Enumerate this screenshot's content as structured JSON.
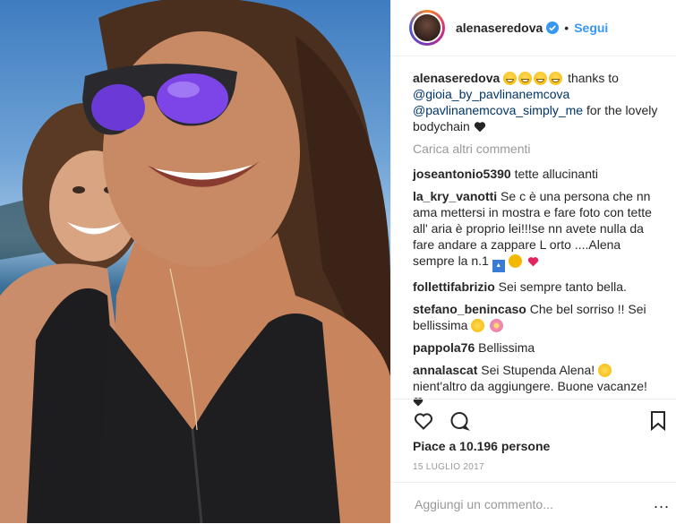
{
  "post": {
    "username": "alenaseredova",
    "separator": "•",
    "follow_label": "Segui",
    "caption": {
      "user": "alenaseredova",
      "text_before": " thanks to",
      "mention1": "@gioia_by_pavlinanemcova",
      "mention2": "@pavlinanemcova_simply_me",
      "text_after": " for the lovely bodychain"
    },
    "load_more": "Carica altri commenti",
    "comments": [
      {
        "user": "joseantonio5390",
        "text": " tette allucinanti"
      },
      {
        "user": "la_kry_vanotti",
        "text": " Se c è una persona che nn ama mettersi in mostra e fare foto con tette all' aria è proprio lei!!!se nn avete nulla da fare andare a zappare L orto ....Alena sempre la n.1 "
      },
      {
        "user": "follettifabrizio",
        "text": " Sei sempre tanto bella."
      },
      {
        "user": "stefano_benincaso",
        "text": " Che bel sorriso !! Sei bellissima "
      },
      {
        "user": "pappola76",
        "text": " Bellissima"
      },
      {
        "user": "annalascat",
        "text": " Sei Stupenda Alena! "
      },
      {
        "text": "nient'altro da aggiungere. Buone vacanze!"
      }
    ],
    "likes": "Piace a 10.196 persone",
    "date": "15 LUGLIO 2017",
    "add_comment_placeholder": "Aggiungi un commento...",
    "more_options": "..."
  },
  "icons": [
    "heart-icon",
    "comment-icon",
    "bookmark-icon",
    "verified-icon"
  ],
  "colors": {
    "link": "#3897f0",
    "mention": "#003569",
    "muted": "#999999",
    "border": "#efefef",
    "text": "#262626"
  }
}
